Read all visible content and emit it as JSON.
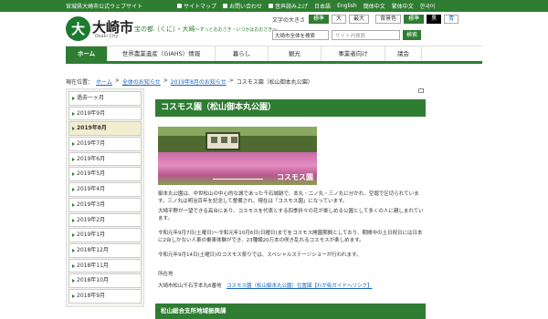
{
  "header": {
    "site_label": "宮城県大崎市公式ウェブサイト",
    "links": [
      "サイトマップ",
      "お問い合わせ",
      "音声読み上げ",
      "日本語",
      "English",
      "簡体中文",
      "繁体中文",
      "한국어"
    ],
    "logo_glyph": "大",
    "logo_name": "大崎市",
    "logo_sub": "Osaki City",
    "tagline_main": "宝の都（くに）・大崎",
    "tagline_sub": "～ずっとおおさき・いつかはおおさき～",
    "textsize_label": "文字の大きさ",
    "textsize_buttons": [
      "標準",
      "大",
      "最大"
    ],
    "bg_label": "背景色",
    "bg_buttons": [
      "標準",
      "黒",
      "青"
    ],
    "search_scope": "大崎市全体を検索",
    "search_placeholder": "サイト内検索",
    "search_button": "検索"
  },
  "nav": [
    "ホーム",
    "世界農業遺産（GIAHS）情報",
    "暮らし",
    "観光",
    "事業者向け",
    "議会"
  ],
  "breadcrumb": {
    "prefix": "現在位置：",
    "items": [
      "ホーム",
      "全体のお知らせ",
      "2019年8月のお知らせ"
    ],
    "sep": ">",
    "current": "コスモス園（松山御本丸公園）"
  },
  "sidebar": [
    "過去一ヶ月",
    "2019年9月",
    "2019年8月",
    "2019年7月",
    "2019年6月",
    "2019年5月",
    "2019年4月",
    "2019年3月",
    "2019年2月",
    "2019年1月",
    "2018年12月",
    "2018年11月",
    "2018年10月",
    "2018年9月"
  ],
  "sidebar_active_index": 2,
  "article": {
    "title": "コスモス園（松山御本丸公園）",
    "photo_caption": "コスモス園",
    "p1": "御本丸公園は、中世松山の中心的な城であった千石城跡で、本丸・二ノ丸・三ノ丸に分かれ、空堀で区切られています。三ノ丸は明治百年を記念して整備され、現在は「コスモス園」になっています。",
    "p2": "大崎平野が一望できる高台にあり、コスモスを代表とする四季折々の花が楽しめる公園として多くの人に親しまれています。",
    "p3": "令和元年9月7日(土曜日)～令和元年10月6日(日曜日)までをコスモス開園期間としており、期間中の土日祝日には日本に2台しかない人車の乗車体験ができ、23種類20万本の咲き乱れるコスモスが楽しめます。",
    "p4": "令和元年9月14日(土曜日)のコスモス祭りでは、スペシャルステージショーが行われます。",
    "location_label": "所在地",
    "address": "大崎市松山千石字本丸6番地",
    "map_link": "コスモス園（松山御本丸公園）位置図【わが街ガイドへリンク】",
    "subsection": "松山総合支所地域振興課"
  }
}
